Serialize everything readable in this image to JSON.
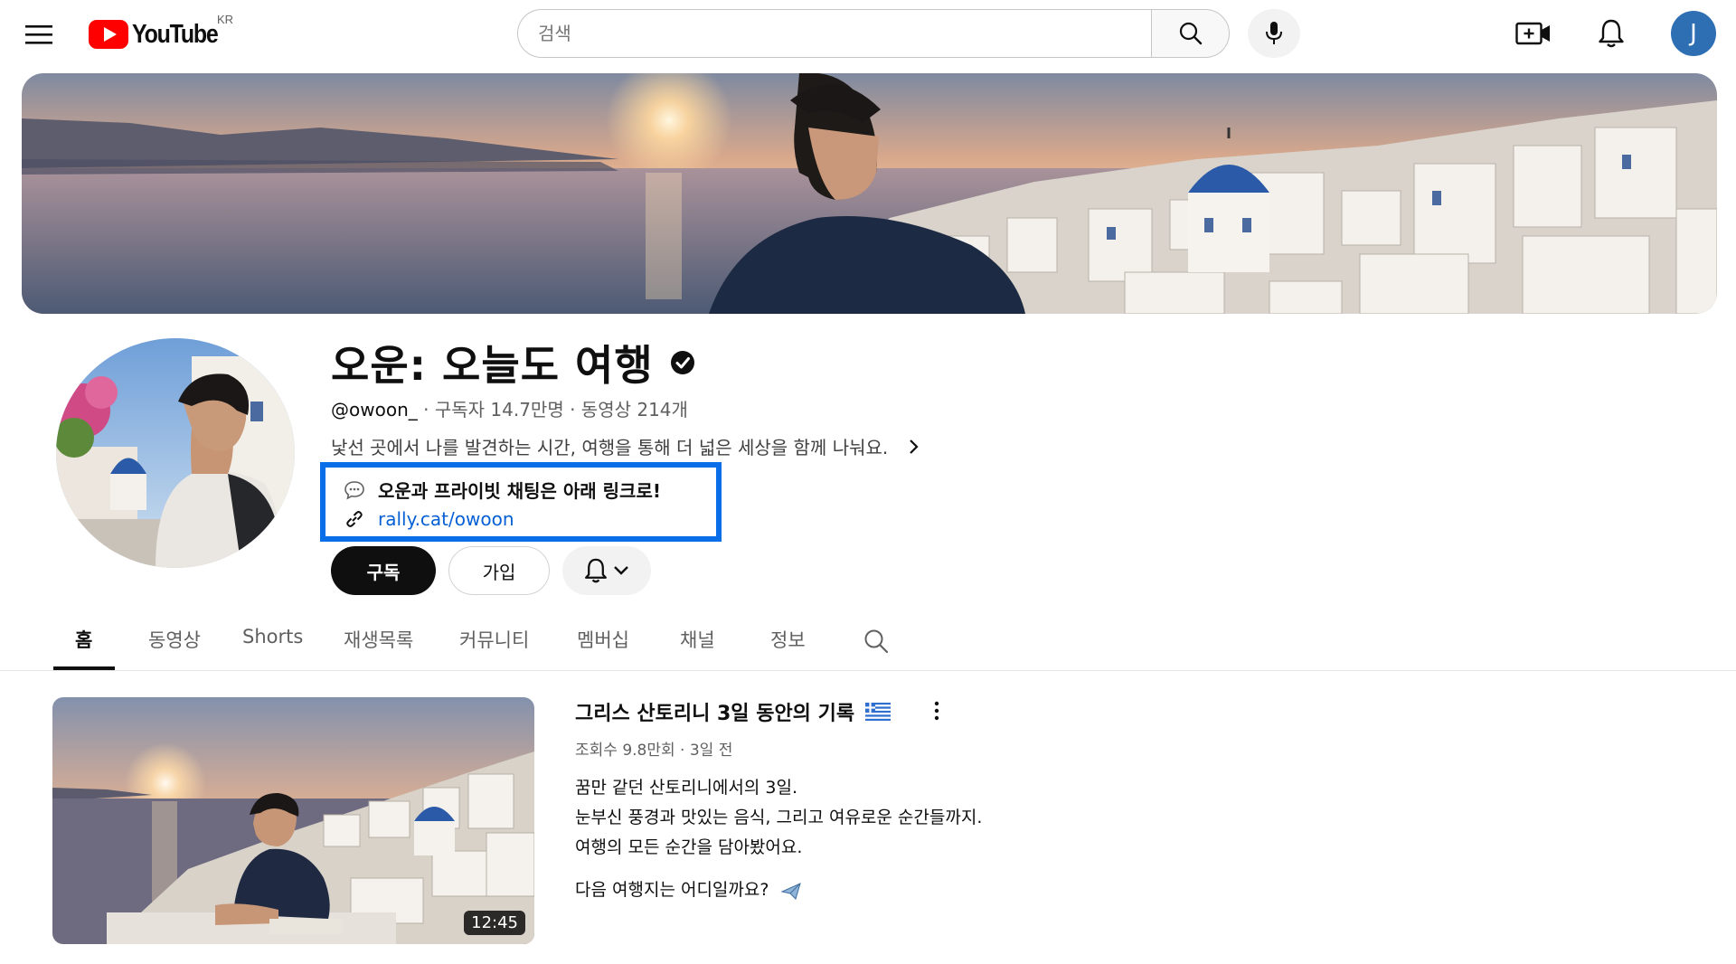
{
  "masthead": {
    "logo_text": "YouTube",
    "country_code": "KR",
    "menu_icon": "hamburger-menu-icon",
    "search": {
      "placeholder": "검색",
      "value": ""
    },
    "icons": [
      "search-icon",
      "microphone-icon",
      "create-video-icon",
      "bell-icon"
    ],
    "avatar_initial": "J",
    "colors": {
      "logo_red": "#ff0000",
      "avatar_bg": "#2e6fb3"
    }
  },
  "channel": {
    "name": "오운: 오늘도 여행",
    "verified_icon": "verified-check-icon",
    "handle": "@owoon_",
    "separator": "·",
    "subscribers": "구독자 14.7만명",
    "videos": "동영상 214개",
    "description": "낯선 곳에서 나를 발견하는 시간, 여행을 통해 더 넓은 세상을 함께 나눠요.",
    "link_box": {
      "chat_icon": "chat-bubble-icon",
      "promo_text": "오운과 프라이빗 채팅은 아래 링크로!",
      "link_icon": "link-icon",
      "link_url": "rally.cat/owoon",
      "highlight_color": "#0a6ee8"
    },
    "buttons": {
      "subscribe": "구독",
      "join": "가입",
      "notify_icon": "bell-icon"
    }
  },
  "tabs": [
    {
      "label": "홈",
      "active": true
    },
    {
      "label": "동영상",
      "active": false
    },
    {
      "label": "Shorts",
      "active": false
    },
    {
      "label": "재생목록",
      "active": false
    },
    {
      "label": "커뮤니티",
      "active": false
    },
    {
      "label": "멤버십",
      "active": false
    },
    {
      "label": "채널",
      "active": false
    },
    {
      "label": "정보",
      "active": false
    }
  ],
  "featured_video": {
    "title": "그리스 산토리니 3일 동안의 기록",
    "title_flag_icon": "greece-flag-icon",
    "views": "조회수 9.8만회",
    "age": "3일 전",
    "duration": "12:45",
    "description_lines": [
      "꿈만 같던 산토리니에서의 3일.",
      "눈부신 풍경과 맛있는 음식, 그리고 여유로운 순간들까지.",
      "여행의 모든 순간을 담아봤어요.",
      "다음 여행지는 어디일까요?"
    ],
    "last_line_icon": "airplane-icon"
  }
}
